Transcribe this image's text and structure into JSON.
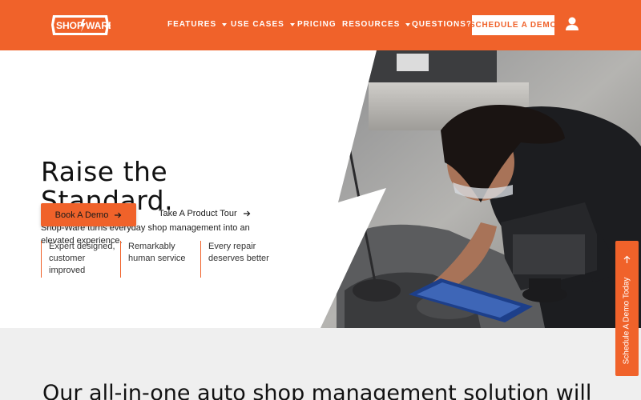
{
  "header": {
    "logo_text": "SHOP WARE",
    "nav": [
      {
        "label": "FEATURES",
        "dropdown": true
      },
      {
        "label": "USE CASES",
        "dropdown": true
      },
      {
        "label": "PRICING",
        "dropdown": false
      },
      {
        "label": "RESOURCES",
        "dropdown": true
      },
      {
        "label": "QUESTIONS?",
        "dropdown": false
      }
    ],
    "cta": "SCHEDULE A DEMO",
    "account_icon": "user-icon"
  },
  "hero": {
    "title_line1": "Raise the",
    "title_line2": "Standard.",
    "subtitle": "Shop-Ware turns everyday shop management into an elevated experience.",
    "primary_button": "Book A Demo",
    "secondary_link": "Take A Product Tour",
    "features": [
      "Expert designed, customer improved",
      "Remarkably human service",
      "Every repair deserves better"
    ],
    "image": "technician-with-tablet-photo"
  },
  "side_tab": {
    "label": "Schedule A Demo Today"
  },
  "lower": {
    "heading": "Our all-in-one auto shop management solution will"
  },
  "colors": {
    "brand": "#f0622a",
    "text": "#111111",
    "lower_bg": "#efefef"
  }
}
